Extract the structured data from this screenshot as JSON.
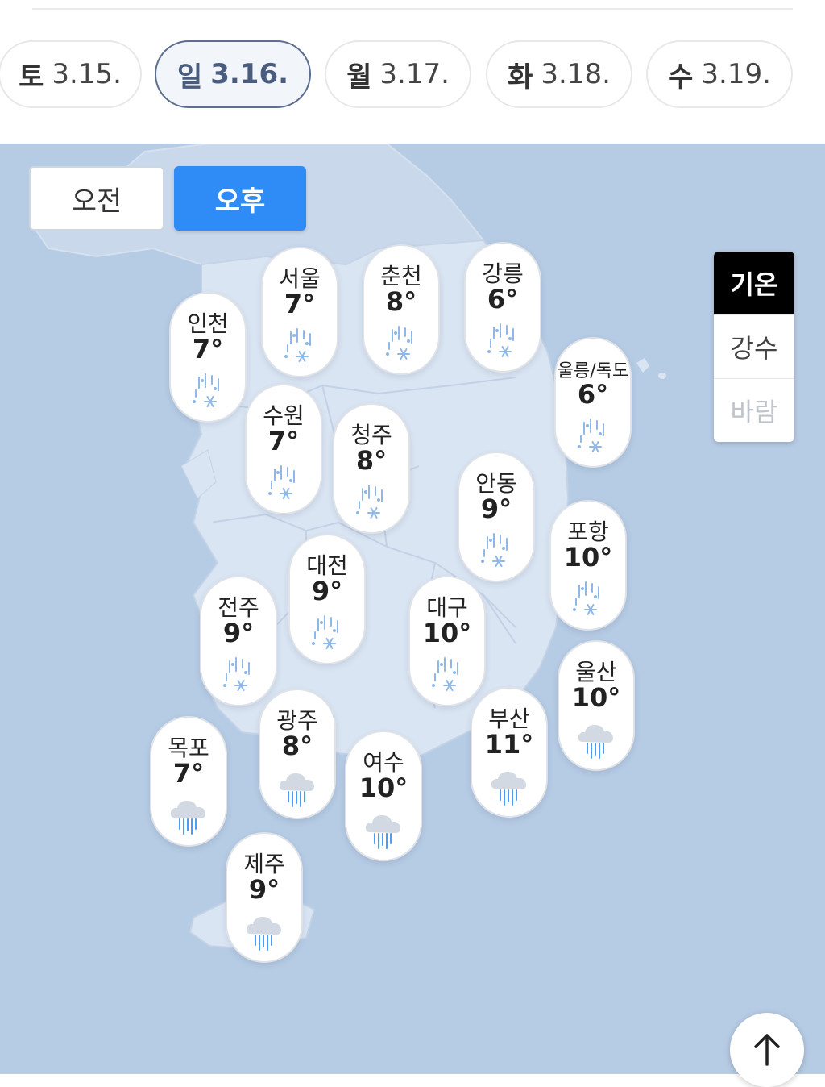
{
  "dates": [
    {
      "day": "토",
      "date": "3.15."
    },
    {
      "day": "일",
      "date": "3.16."
    },
    {
      "day": "월",
      "date": "3.17."
    },
    {
      "day": "화",
      "date": "3.18."
    },
    {
      "day": "수",
      "date": "3.19."
    }
  ],
  "time_toggle": {
    "am": "오전",
    "pm": "오후"
  },
  "layers": {
    "temperature": "기온",
    "precipitation": "강수",
    "wind": "바람"
  },
  "cities": [
    {
      "name": "서울",
      "temp": "7°",
      "icon": "snow-rain-icon"
    },
    {
      "name": "춘천",
      "temp": "8°",
      "icon": "snow-rain-icon"
    },
    {
      "name": "강릉",
      "temp": "6°",
      "icon": "snow-rain-icon"
    },
    {
      "name": "인천",
      "temp": "7°",
      "icon": "snow-rain-icon"
    },
    {
      "name": "울릉/독도",
      "temp": "6°",
      "icon": "snow-rain-icon"
    },
    {
      "name": "수원",
      "temp": "7°",
      "icon": "snow-rain-icon"
    },
    {
      "name": "청주",
      "temp": "8°",
      "icon": "snow-rain-icon"
    },
    {
      "name": "안동",
      "temp": "9°",
      "icon": "snow-rain-icon"
    },
    {
      "name": "포항",
      "temp": "10°",
      "icon": "snow-rain-icon"
    },
    {
      "name": "대전",
      "temp": "9°",
      "icon": "snow-rain-icon"
    },
    {
      "name": "전주",
      "temp": "9°",
      "icon": "snow-rain-icon"
    },
    {
      "name": "대구",
      "temp": "10°",
      "icon": "snow-rain-icon"
    },
    {
      "name": "울산",
      "temp": "10°",
      "icon": "cloud-rain-icon"
    },
    {
      "name": "광주",
      "temp": "8°",
      "icon": "cloud-rain-icon"
    },
    {
      "name": "부산",
      "temp": "11°",
      "icon": "cloud-rain-icon"
    },
    {
      "name": "목포",
      "temp": "7°",
      "icon": "cloud-rain-icon"
    },
    {
      "name": "여수",
      "temp": "10°",
      "icon": "cloud-rain-icon"
    },
    {
      "name": "제주",
      "temp": "9°",
      "icon": "cloud-rain-icon"
    }
  ],
  "colors": {
    "accent": "#2f8cf6",
    "map_sea": "#b6cbe4",
    "map_land": "#dae5f3",
    "active_layer": "#000000"
  }
}
